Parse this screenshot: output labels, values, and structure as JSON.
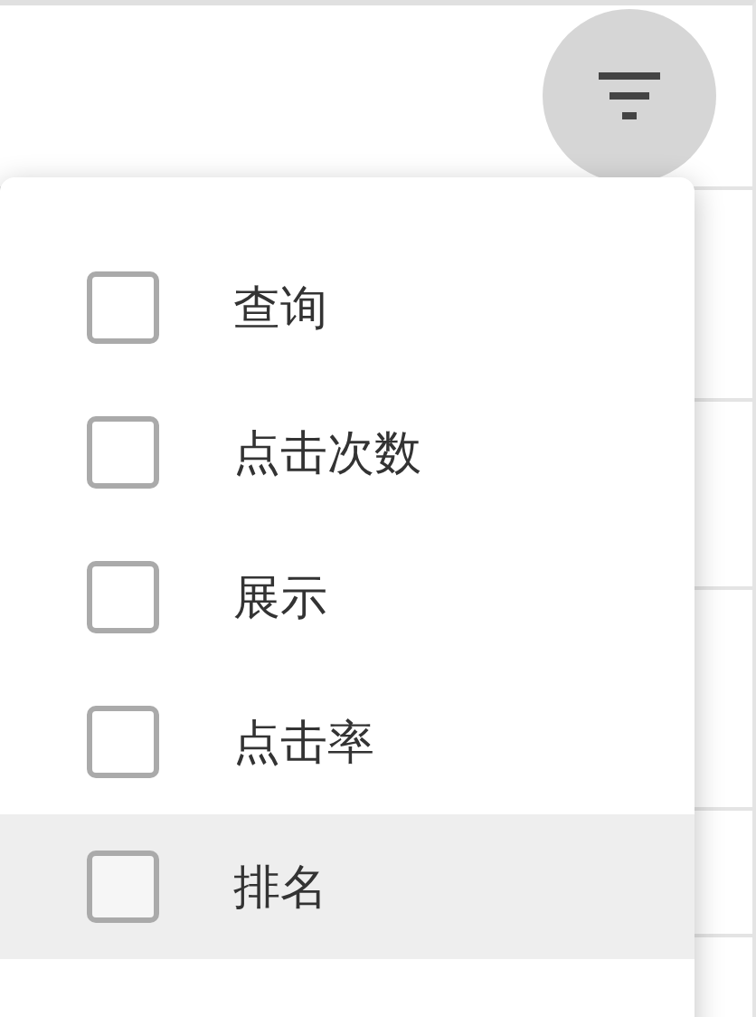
{
  "filter_menu": {
    "items": [
      {
        "label": "查询",
        "checked": false,
        "highlighted": false
      },
      {
        "label": "点击次数",
        "checked": false,
        "highlighted": false
      },
      {
        "label": "展示",
        "checked": false,
        "highlighted": false
      },
      {
        "label": "点击率",
        "checked": false,
        "highlighted": false
      },
      {
        "label": "排名",
        "checked": false,
        "highlighted": true
      }
    ]
  }
}
